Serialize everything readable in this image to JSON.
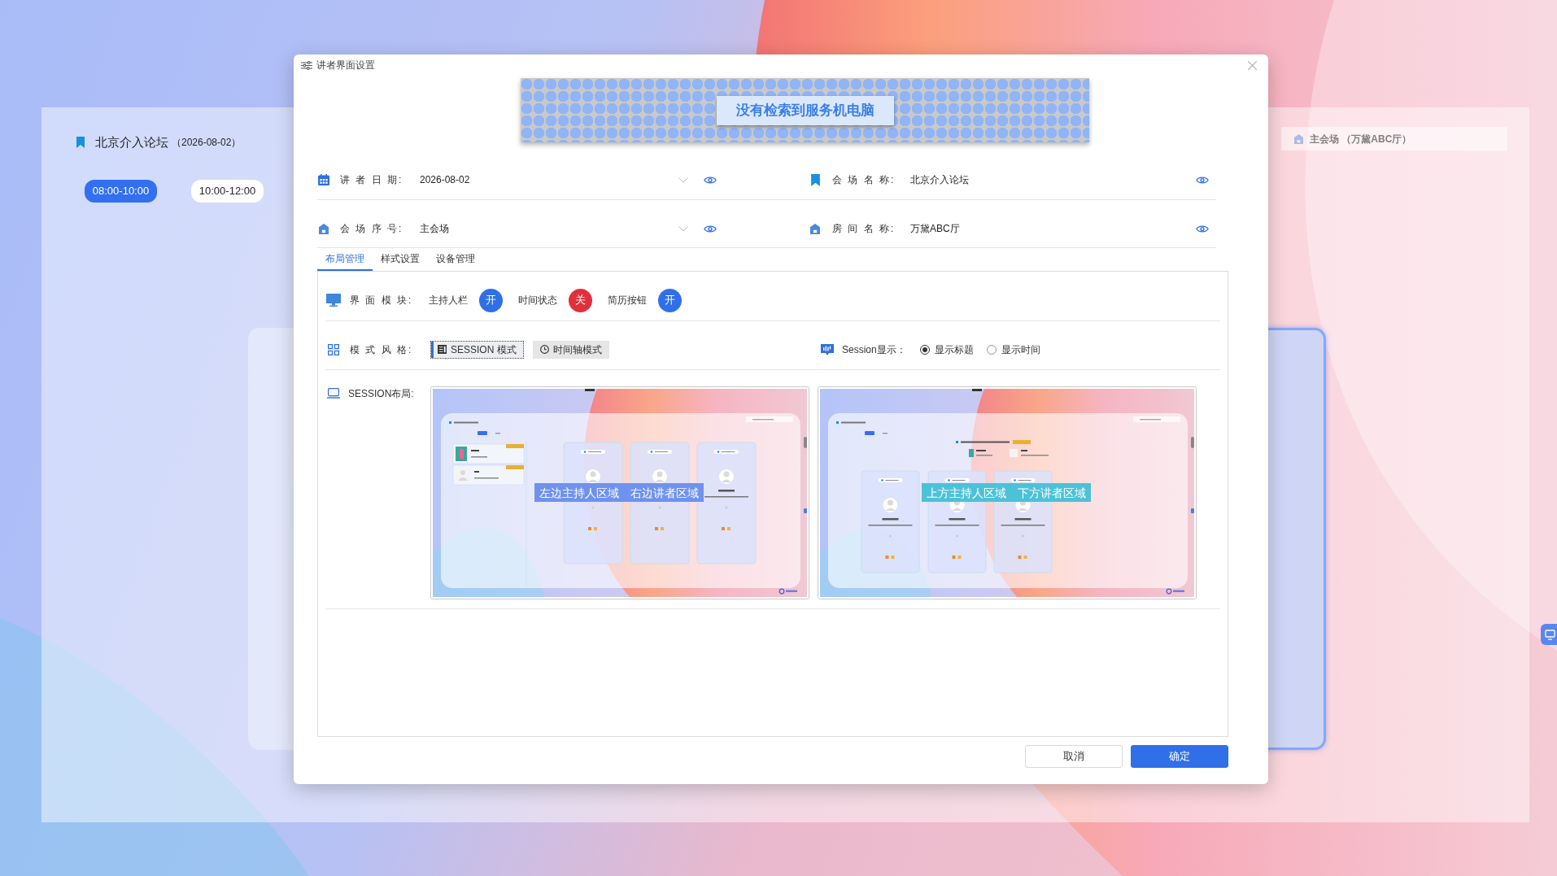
{
  "background": {
    "title": "北京介入论坛",
    "date": "（2026-08-02）",
    "time_slots": [
      {
        "label": "08:00-10:00",
        "selected": true
      },
      {
        "label": "10:00-12:00",
        "selected": false
      }
    ],
    "venue": "主会场 （万黛ABC厅）"
  },
  "dialog": {
    "title": "讲者界面设置",
    "notice": "没有检索到服务机电脑",
    "fields": [
      {
        "kind": "select",
        "label": "讲 者 日 期:",
        "value": "2026-08-02"
      },
      {
        "kind": "text",
        "label": "会 场 名 称:",
        "value": "北京介入论坛"
      },
      {
        "kind": "select",
        "label": "会 场 序 号:",
        "value": "主会场"
      },
      {
        "kind": "text",
        "label": "房 间 名 称:",
        "value": "万黛ABC厅"
      }
    ],
    "tabs": [
      {
        "label": "布局管理",
        "selected": true
      },
      {
        "label": "样式设置",
        "selected": false
      },
      {
        "label": "设备管理",
        "selected": false
      }
    ],
    "modules": {
      "label": "界 面 模 块:",
      "toggles": [
        {
          "label": "主持人栏",
          "on": true,
          "state_text": "开"
        },
        {
          "label": "时间状态",
          "on": false,
          "state_text": "关"
        },
        {
          "label": "简历按钮",
          "on": true,
          "state_text": "开"
        }
      ]
    },
    "style": {
      "label": "模 式 风 格:",
      "modes": [
        {
          "label": "SESSION 模式",
          "selected": true
        },
        {
          "label": "时间轴模式",
          "selected": false
        }
      ]
    },
    "session_display": {
      "label": "Session显示：",
      "options": [
        {
          "label": "显示标题",
          "selected": true
        },
        {
          "label": "显示时间",
          "selected": false
        }
      ]
    },
    "layout": {
      "label": "SESSION布局:",
      "previews": [
        {
          "kind": "horizontal",
          "color": "#6f92ef",
          "captions": [
            "左边主持人区域",
            "右边讲者区域"
          ]
        },
        {
          "kind": "vertical",
          "color": "#4cc2d8",
          "captions": [
            "上方主持人区域",
            "下方讲者区域"
          ]
        }
      ]
    },
    "buttons": [
      {
        "kind": "secondary",
        "label": "取消"
      },
      {
        "kind": "primary",
        "label": "确定"
      }
    ]
  }
}
